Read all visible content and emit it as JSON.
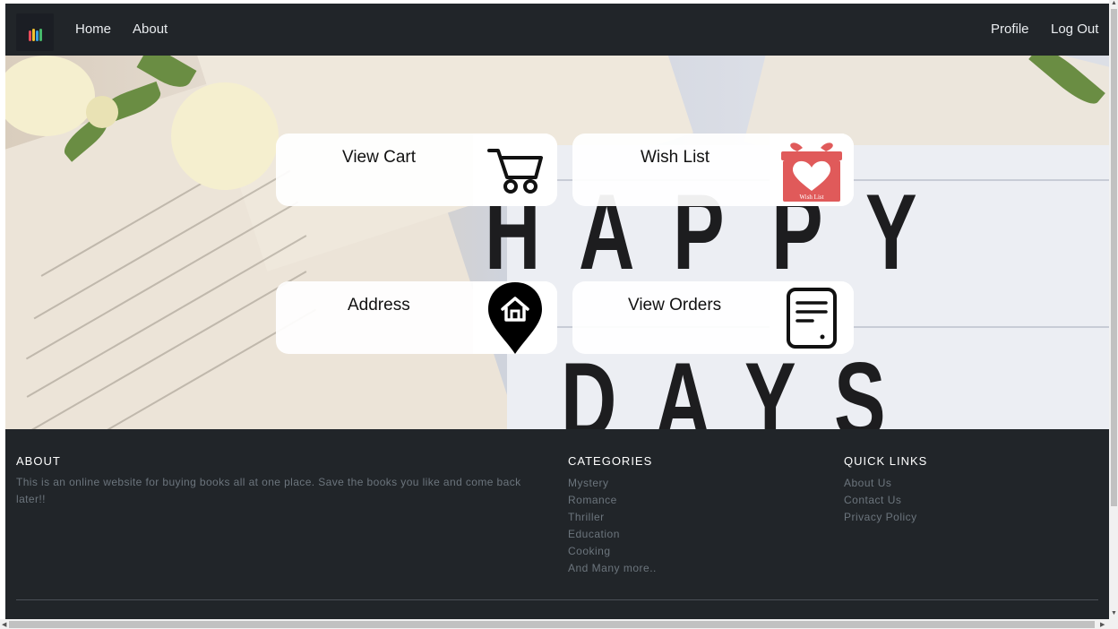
{
  "nav": {
    "brand_colors": [
      "#e94b5a",
      "#f2c230",
      "#3aa0e0",
      "#46b86a"
    ],
    "left_links": [
      {
        "label": "Home"
      },
      {
        "label": "About"
      }
    ],
    "right_links": [
      {
        "label": "Profile"
      },
      {
        "label": "Log Out"
      }
    ]
  },
  "hero": {
    "sign_line1": [
      "H",
      "A",
      "P",
      "P",
      "Y"
    ],
    "sign_line2": [
      "D",
      "A",
      "Y",
      "S"
    ]
  },
  "cards": {
    "view_cart": {
      "label": "View Cart",
      "icon": "shopping-cart-icon"
    },
    "wish_list": {
      "label": "Wish List",
      "icon": "gift-heart-icon",
      "icon_caption": "Wish List",
      "icon_color": "#e05a5a"
    },
    "address": {
      "label": "Address",
      "icon": "home-location-pin-icon"
    },
    "view_orders": {
      "label": "View Orders",
      "icon": "order-document-icon"
    }
  },
  "footer": {
    "about": {
      "title": "ABOUT",
      "text": "This is an online website for buying books all at one place. Save the books you like and come back later!!"
    },
    "categories": {
      "title": "CATEGORIES",
      "items": [
        "Mystery",
        "Romance",
        "Thriller",
        "Education",
        "Cooking",
        "And Many more.."
      ]
    },
    "quick_links": {
      "title": "QUICK LINKS",
      "items": [
        "About Us",
        "Contact Us",
        "Privacy Policy"
      ]
    }
  },
  "colors": {
    "nav_bg": "#212529",
    "footer_bg": "#212529",
    "footer_muted_text": "#6c757d",
    "card_bg": "#ffffff"
  }
}
